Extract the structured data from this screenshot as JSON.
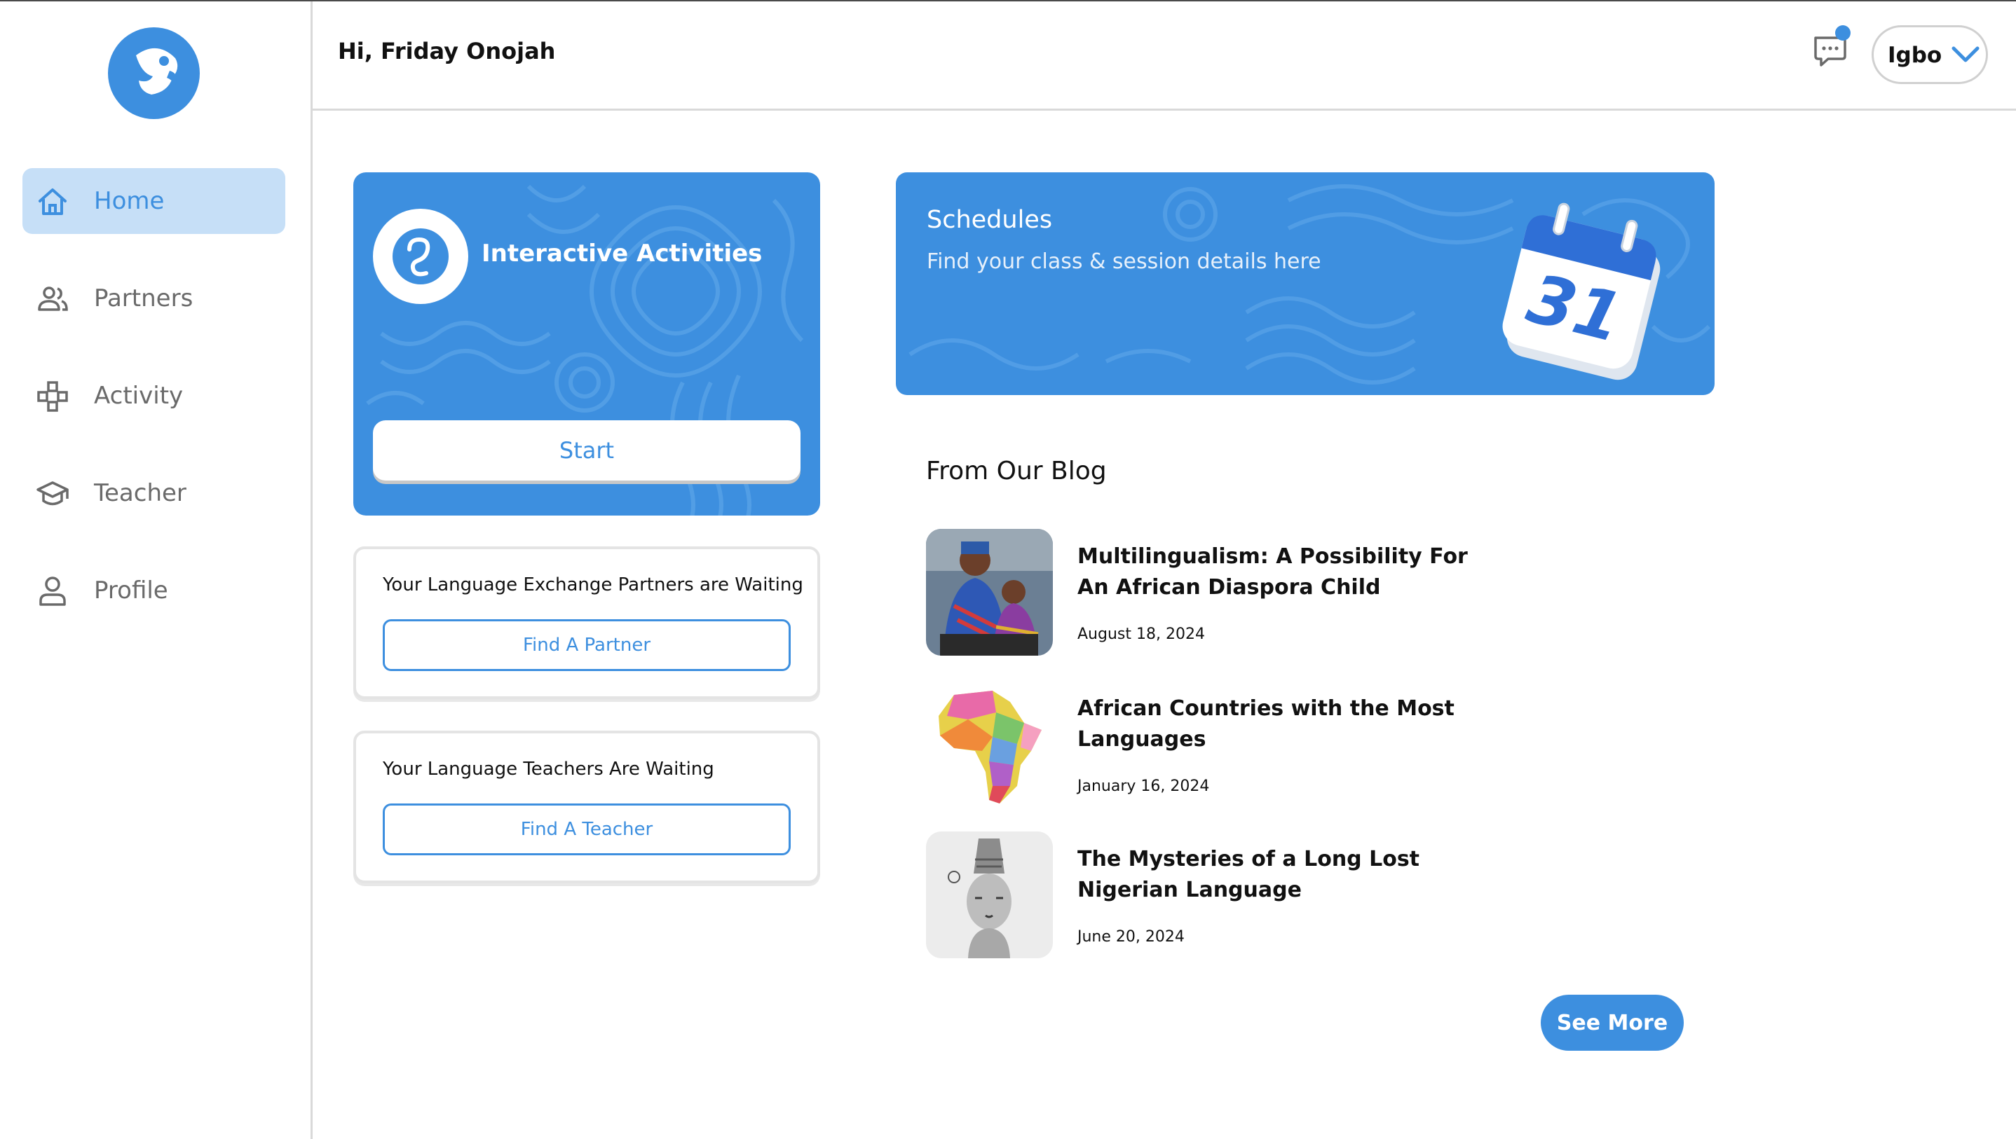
{
  "header": {
    "greeting": "Hi, Friday Onojah",
    "chat_icon": "chat-bubble-icon",
    "language": "Igbo"
  },
  "sidebar": {
    "items": [
      {
        "label": "Home",
        "icon": "home-icon",
        "active": true
      },
      {
        "label": "Partners",
        "icon": "people-icon",
        "active": false
      },
      {
        "label": "Activity",
        "icon": "gamepad-icon",
        "active": false
      },
      {
        "label": "Teacher",
        "icon": "graduation-cap-icon",
        "active": false
      },
      {
        "label": "Profile",
        "icon": "user-icon",
        "active": false
      }
    ]
  },
  "activities": {
    "title": "Interactive Activities",
    "start_label": "Start"
  },
  "partners_card": {
    "text": "Your Language Exchange Partners are Waiting",
    "button": "Find A Partner"
  },
  "teachers_card": {
    "text": "Your Language Teachers Are Waiting",
    "button": "Find A Teacher"
  },
  "schedules": {
    "title": "Schedules",
    "subtitle": "Find your class & session details here",
    "calendar_day": "31"
  },
  "blog": {
    "heading": "From Our Blog",
    "posts": [
      {
        "title": "Multilingualism: A Possibility For An African Diaspora Child",
        "date": "August 18, 2024"
      },
      {
        "title": "African Countries with the Most Languages",
        "date": "January 16, 2024"
      },
      {
        "title": "The Mysteries of a Long Lost Nigerian Language",
        "date": "June 20, 2024"
      }
    ],
    "see_more": "See More"
  },
  "colors": {
    "accent": "#3d8fdf",
    "active_bg": "#c6dff7",
    "muted_text": "#6a6a6a"
  }
}
